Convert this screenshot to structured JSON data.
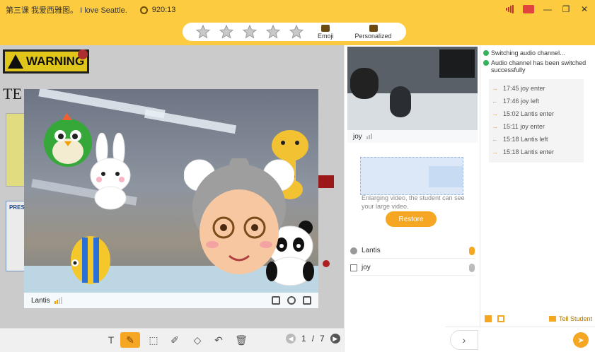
{
  "titlebar": {
    "title": "第三课 我爱西雅图。 I love Seattle.",
    "timer": "920:13"
  },
  "toolbar": {
    "stars": [
      1,
      2,
      3,
      4,
      5
    ],
    "emoji_label": "Emoji",
    "personalized_label": "Personalized",
    "star_color": "#c9c9c9"
  },
  "whiteboard": {
    "warning_text": "WARNING",
    "te_text": "TE",
    "pre_text": "PRES"
  },
  "video": {
    "name": "Lantis"
  },
  "bottombar": {
    "page_current": "1",
    "page_sep": " / ",
    "page_total": "7"
  },
  "student_video": {
    "name": "joy",
    "hint": "Enlarging video, the student can see your large video.",
    "restore_label": "Restore"
  },
  "members": [
    {
      "name": "Lantis"
    },
    {
      "name": "joy"
    }
  ],
  "chat": {
    "messages": [
      "Switching audio channel...",
      "Audio channel has been switched successfully"
    ],
    "log": [
      {
        "text": "17:45 joy enter"
      },
      {
        "text": "17:46 joy left"
      },
      {
        "text": "15:02 Lantis enter"
      },
      {
        "text": "15:11 joy enter"
      },
      {
        "text": "15:18 Lantis left"
      },
      {
        "text": "15:18 Lantis enter"
      }
    ],
    "tell_student_label": "Tell Student"
  },
  "colors": {
    "accent": "#fccb40",
    "button": "#f5a623",
    "success": "#36b35a"
  }
}
